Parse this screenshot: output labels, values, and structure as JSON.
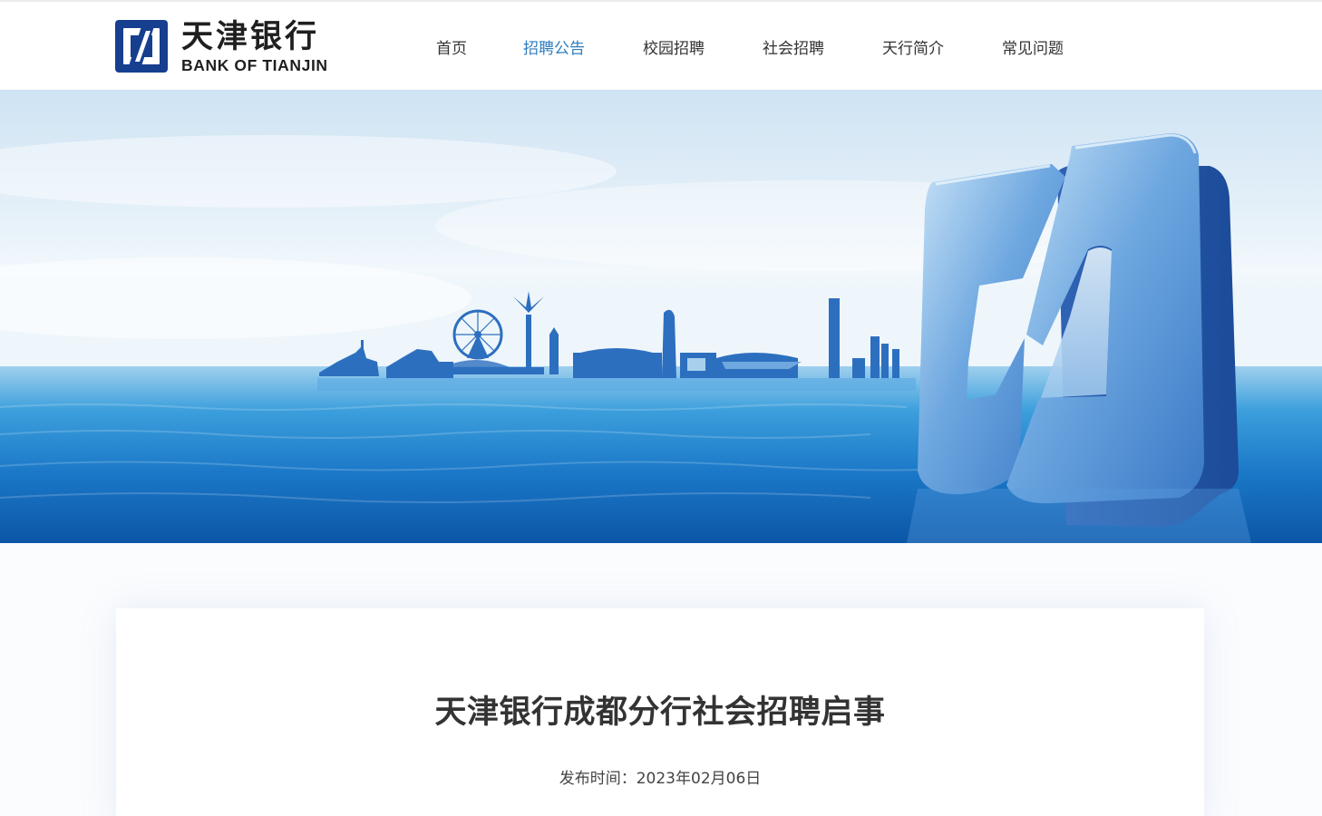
{
  "brand": {
    "name_cn": "天津银行",
    "name_en": "BANK OF TIANJIN",
    "primary_color": "#163f8f",
    "accent_color": "#2f7ec0"
  },
  "nav": {
    "items": [
      {
        "label": "首页",
        "active": false
      },
      {
        "label": "招聘公告",
        "active": true
      },
      {
        "label": "校园招聘",
        "active": false
      },
      {
        "label": "社会招聘",
        "active": false
      },
      {
        "label": "天行简介",
        "active": false
      },
      {
        "label": "常见问题",
        "active": false
      }
    ]
  },
  "banner": {
    "icon": "bank-3d-logo-icon"
  },
  "article": {
    "title": "天津银行成都分行社会招聘启事",
    "publish_label": "发布时间：",
    "publish_date": "2023年02月06日"
  }
}
